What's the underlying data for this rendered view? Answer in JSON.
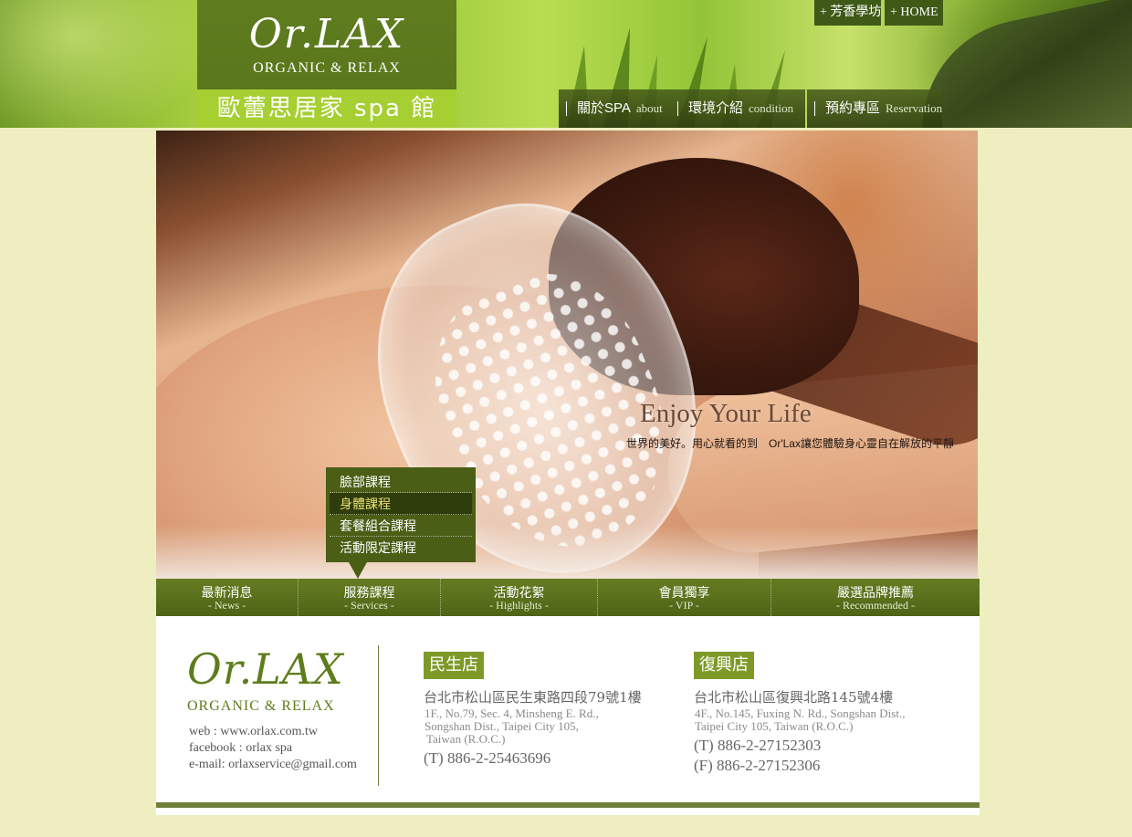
{
  "header": {
    "logo_script": "Or.LAX",
    "logo_subtitle": "ORGANIC & RELAX",
    "logo_cn": "歐蕾思居家 spa 館",
    "top_links": [
      {
        "label": "+ 芳香學坊"
      },
      {
        "label": "+ HOME"
      }
    ],
    "nav": [
      {
        "cn": "關於SPA",
        "en": "about"
      },
      {
        "cn": "環境介紹",
        "en": "condition"
      },
      {
        "cn": "預約專區",
        "en": "Reservation"
      }
    ]
  },
  "hero": {
    "title": "Enjoy Your Life",
    "subtitle": "世界的美好。用心就看的到　Or'Lax讓您體驗身心靈自在解放的平靜"
  },
  "submenu": {
    "items": [
      {
        "label": "臉部課程",
        "active": false
      },
      {
        "label": "身體課程",
        "active": true
      },
      {
        "label": "套餐組合課程",
        "active": false
      },
      {
        "label": "活動限定課程",
        "active": false
      }
    ]
  },
  "bottom_nav": [
    {
      "cn": "最新消息",
      "en": "- News -"
    },
    {
      "cn": "服務課程",
      "en": "- Services -"
    },
    {
      "cn": "活動花絮",
      "en": "- Highlights -"
    },
    {
      "cn": "會員獨享",
      "en": "- VIP -"
    },
    {
      "cn": "嚴選品牌推薦",
      "en": "- Recommended -"
    }
  ],
  "footer": {
    "logo_script": "Or.LAX",
    "logo_subtitle": "ORGANIC & RELAX",
    "web": "web : www.orlax.com.tw",
    "facebook": "facebook : orlax spa",
    "email": "e-mail: orlaxservice@gmail.com",
    "stores": [
      {
        "name": "民生店",
        "address_cn": "台北市松山區民生東路四段79號1樓",
        "address_en": [
          "1F., No.79, Sec. 4, Minsheng E. Rd.,",
          "Songshan Dist., Taipei City 105,",
          "Taiwan (R.O.C.)"
        ],
        "tel": "(T) 886-2-25463696"
      },
      {
        "name": "復興店",
        "address_cn": "台北市松山區復興北路145號4樓",
        "address_en": [
          "4F., No.145, Fuxing N. Rd., Songshan Dist.,",
          "Taipei City 105, Taiwan (R.O.C.)"
        ],
        "tel": "(T) 886-2-27152303",
        "fax": "(F) 886-2-27152306"
      }
    ]
  },
  "colors": {
    "page_bg": "#efeec0",
    "brand_green": "#5f7d1f",
    "accent_lime": "#a6cf32",
    "nav_dark": "#4d6416"
  }
}
